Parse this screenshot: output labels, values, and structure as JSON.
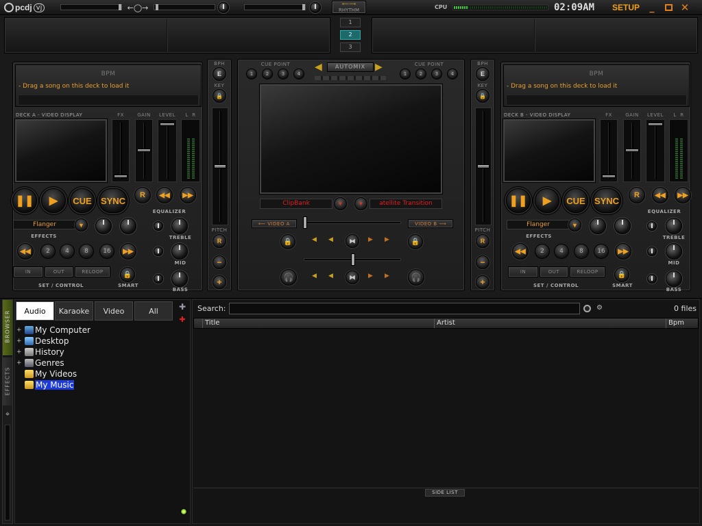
{
  "titlebar": {
    "logo": "pcdj",
    "logo_badge": "vj",
    "rhythm_label": "RHYTHM",
    "cpu_label": "CPU",
    "clock": "02:09AM",
    "setup_label": "SETUP",
    "minimize_icon": "minimize-icon",
    "maximize_icon": "maximize-icon",
    "close_icon": "close-icon"
  },
  "monitor_tabs": [
    "1",
    "2",
    "3"
  ],
  "deck_a": {
    "bpm_label": "BPM",
    "drag_text": "- Drag a song on this deck to load it",
    "video_label": "DECK A - VIDEO DISPLAY",
    "fx_label": "FX",
    "gain_label": "GAIN",
    "level_label": "LEVEL",
    "lr_label": "L  R",
    "cue_label": "CUE",
    "sync_label": "SYNC",
    "r_label": "R",
    "effect_value": "Flanger",
    "effects_label": "EFFECTS",
    "equalizer_label": "EQUALIZER",
    "treble_label": "TREBLE",
    "mid_label": "MID",
    "bass_label": "BASS",
    "loops": [
      "2",
      "4",
      "8",
      "16"
    ],
    "in_label": "IN",
    "out_label": "OUT",
    "reloop_label": "RELOOP",
    "set_control_label": "SET / CONTROL",
    "smart_label": "SMART"
  },
  "deck_b": {
    "bpm_label": "BPM",
    "drag_text": "- Drag a song on this deck to load it",
    "video_label": "DECK B - VIDEO DISPLAY",
    "fx_label": "FX",
    "gain_label": "GAIN",
    "level_label": "LEVEL",
    "lr_label": "L  R",
    "cue_label": "CUE",
    "sync_label": "SYNC",
    "r_label": "R",
    "effect_value": "Flanger",
    "effects_label": "EFFECTS",
    "equalizer_label": "EQUALIZER",
    "treble_label": "TREBLE",
    "mid_label": "MID",
    "bass_label": "BASS",
    "loops": [
      "2",
      "4",
      "8",
      "16"
    ],
    "in_label": "IN",
    "out_label": "OUT",
    "reloop_label": "RELOOP",
    "set_control_label": "SET / CONTROL",
    "smart_label": "SMART"
  },
  "pitch": {
    "bph_label": "BPH",
    "key_label": "KEY",
    "pitch_label": "PITCH",
    "e_label": "E",
    "r_label": "R",
    "minus_label": "−",
    "plus_label": "+"
  },
  "center": {
    "cue_point_label": "CUE POINT",
    "cue_points": [
      "1",
      "2",
      "3",
      "4"
    ],
    "automix_label": "AUTOMIX",
    "clipbank_label": "ClipBank",
    "transition_label": "atellite Transition",
    "video_a_label": "⟵ VIDEO A",
    "video_b_label": "VIDEO B ⟶"
  },
  "browser": {
    "side_tabs": [
      "BROWSER",
      "EFFECTS"
    ],
    "tabs": [
      "Audio",
      "Karaoke",
      "Video",
      "All"
    ],
    "active_tab": "Audio",
    "tree": [
      {
        "label": "My Computer",
        "icon": "computer-icon",
        "expandable": true
      },
      {
        "label": "Desktop",
        "icon": "desktop-icon",
        "expandable": true
      },
      {
        "label": "History",
        "icon": "history-icon",
        "expandable": true
      },
      {
        "label": "Genres",
        "icon": "genres-icon",
        "expandable": true
      },
      {
        "label": "My Videos",
        "icon": "folder-icon",
        "expandable": false
      },
      {
        "label": "My Music",
        "icon": "folder-icon",
        "expandable": false,
        "selected": true
      }
    ],
    "search_label": "Search:",
    "search_value": "",
    "files_count": "0 files",
    "columns": [
      "Title",
      "Artist",
      "Bpm"
    ],
    "side_list_label": "SIDE LIST"
  },
  "colors": {
    "accent_orange": "#f0a020",
    "text_orange": "#e8a030",
    "red_text": "#e02020",
    "teal_tab": "#2a8a8a"
  }
}
